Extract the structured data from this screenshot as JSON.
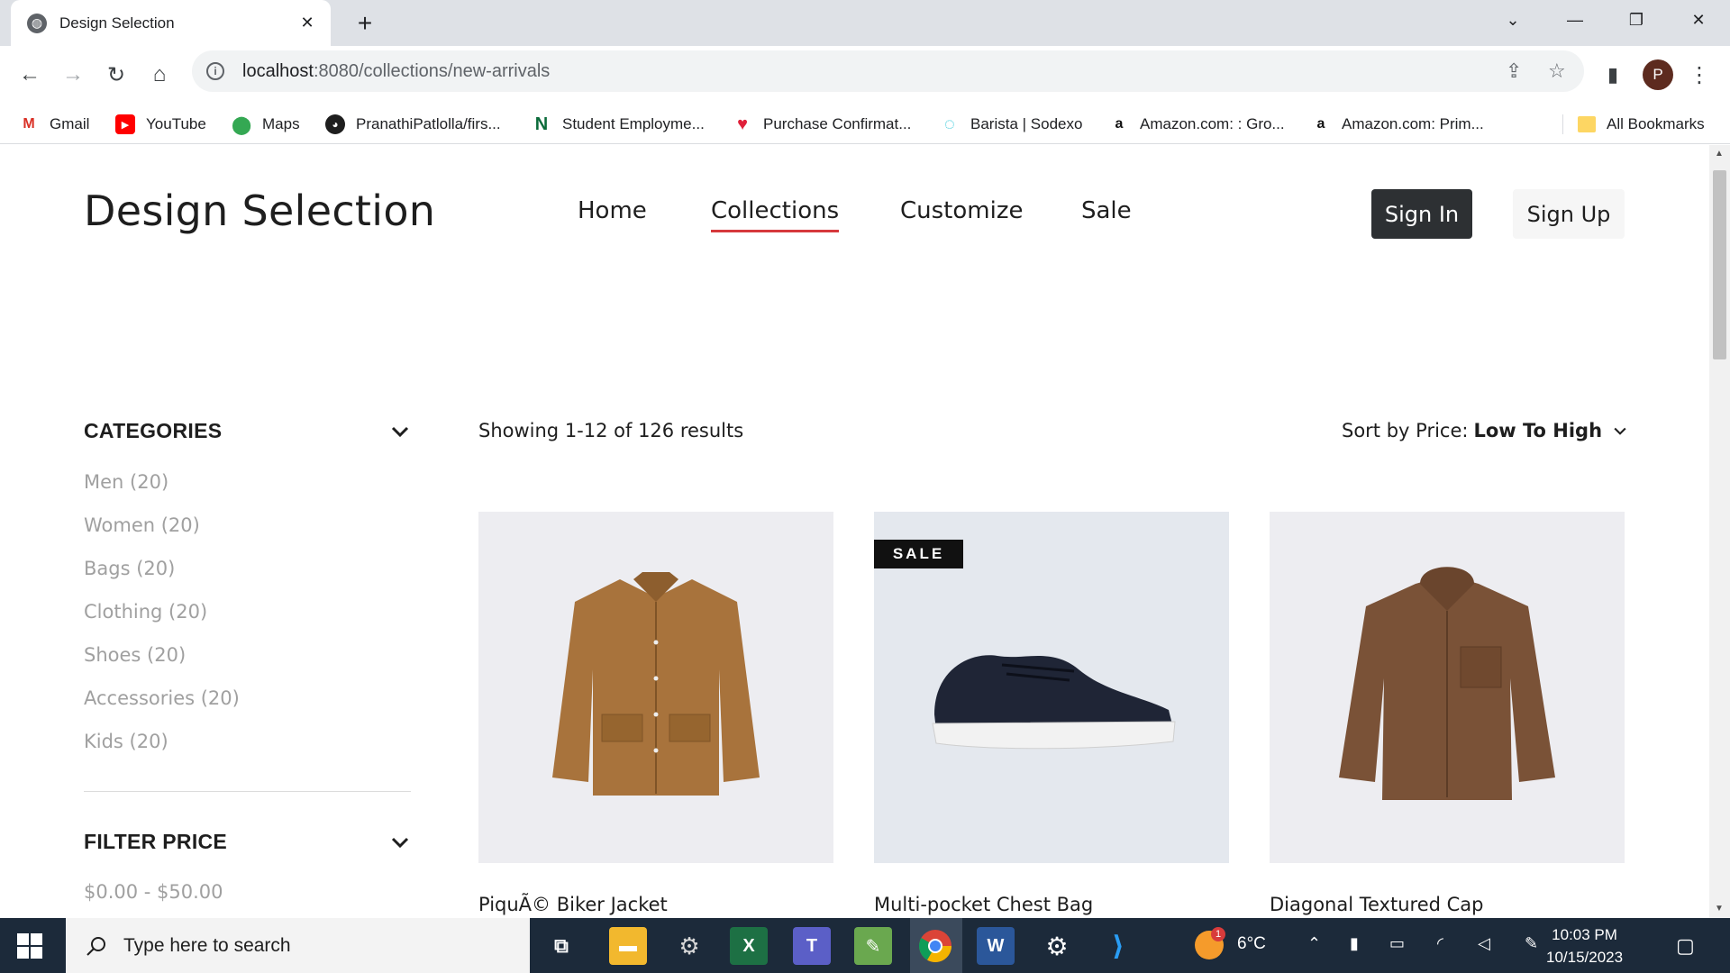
{
  "browser": {
    "tab_title": "Design Selection",
    "url_host": "localhost",
    "url_path": ":8080/collections/new-arrivals",
    "profile_initial": "P",
    "bookmarks": [
      {
        "label": "Gmail",
        "icon": "gmail-icon"
      },
      {
        "label": "YouTube",
        "icon": "youtube-icon"
      },
      {
        "label": "Maps",
        "icon": "maps-icon"
      },
      {
        "label": "PranathiPatlolla/firs...",
        "icon": "github-icon"
      },
      {
        "label": "Student Employme...",
        "icon": "n-icon"
      },
      {
        "label": "Purchase Confirmat...",
        "icon": "heart-icon"
      },
      {
        "label": "Barista | Sodexo",
        "icon": "sodexo-icon"
      },
      {
        "label": "Amazon.com: : Gro...",
        "icon": "amazon-icon"
      },
      {
        "label": "Amazon.com: Prim...",
        "icon": "amazon-icon"
      }
    ],
    "all_bookmarks": "All Bookmarks"
  },
  "site": {
    "brand": "Design Selection",
    "nav": [
      "Home",
      "Collections",
      "Customize",
      "Sale"
    ],
    "active_nav": "Collections",
    "sign_in": "Sign In",
    "sign_up": "Sign Up"
  },
  "sidebar": {
    "categories_title": "CATEGORIES",
    "categories": [
      "Men (20)",
      "Women (20)",
      "Bags (20)",
      "Clothing (20)",
      "Shoes (20)",
      "Accessories (20)",
      "Kids (20)"
    ],
    "filter_title": "FILTER PRICE",
    "price_range": "$0.00 - $50.00"
  },
  "listing": {
    "results_text": "Showing 1-12 of 126 results",
    "sort_label": "Sort by Price:",
    "sort_value": "Low To High",
    "products": [
      {
        "name": "PiquÃ© Biker Jacket",
        "badge": ""
      },
      {
        "name": "Multi-pocket Chest Bag",
        "badge": "SALE"
      },
      {
        "name": "Diagonal Textured Cap",
        "badge": ""
      }
    ]
  },
  "taskbar": {
    "search_placeholder": "Type here to search",
    "weather": "6°C",
    "weather_badge": "1",
    "time": "10:03 PM",
    "date": "10/15/2023"
  }
}
